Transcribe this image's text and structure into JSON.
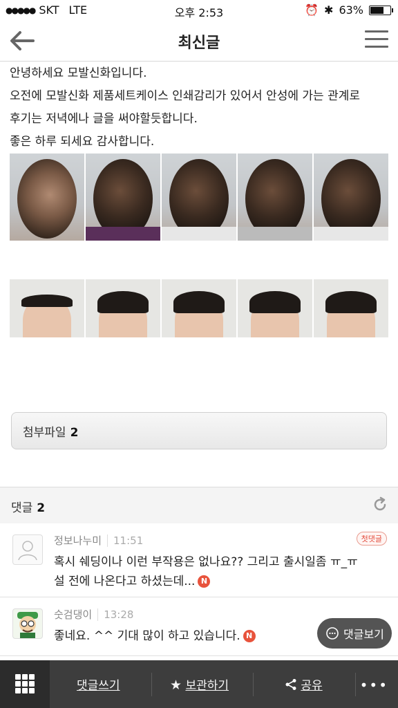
{
  "status": {
    "carrier": "SKT",
    "network": "LTE",
    "time": "오후 2:53",
    "battery": "63%",
    "battery_level": 0.63
  },
  "header": {
    "title": "최신글",
    "back_icon": "arrow-left-icon",
    "menu_icon": "hamburger-icon"
  },
  "post": {
    "lines": [
      "안녕하세요 모발신화입니다.",
      "오전에 모발신화 제품세트케이스 인쇄감리가 있어서 안성에 가는 관계로",
      "후기는 저녁에나 글을 써야할듯합니다.",
      "좋은 하루 되세요 감사합니다."
    ]
  },
  "attachments": {
    "label": "첨부파일",
    "count": "2"
  },
  "comments": {
    "label": "댓글",
    "count": "2",
    "items": [
      {
        "author": "정보나누미",
        "time": "11:51",
        "badge": "첫댓글",
        "line1": "혹시 쉐딩이나 이런 부작용은 없나요?? 그리고 출시일좀 ㅠ_ㅠ",
        "line2": "설 전에 나온다고 하셨는데...",
        "new": "N"
      },
      {
        "author": "숫검댕이",
        "time": "13:28",
        "line1": "좋네요. ^^ 기대 많이 하고 있습니다.",
        "new": "N"
      }
    ],
    "view_button": "댓글보기"
  },
  "toolbar": {
    "write": "댓글쓰기",
    "save": "보관하기",
    "share": "공유",
    "more": "•••"
  }
}
